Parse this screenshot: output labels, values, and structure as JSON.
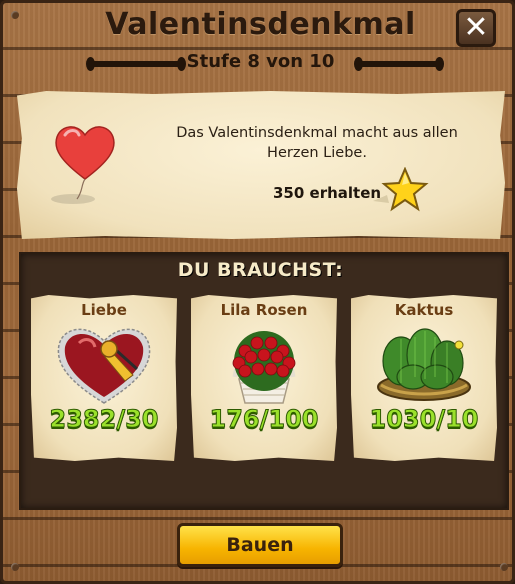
{
  "dialog": {
    "title": "Valentinsdenkmal",
    "level_text": "Stufe 8 von 10",
    "close_label": "✕"
  },
  "info": {
    "description": "Das Valentinsdenkmal macht aus allen Herzen Liebe.",
    "reward_text": "350 erhalten",
    "reward_icon": "star-icon"
  },
  "requirements": {
    "title": "DU BRAUCHST:",
    "items": [
      {
        "name": "Liebe",
        "count": "2382/30",
        "icon": "heart-gift-icon"
      },
      {
        "name": "Lila Rosen",
        "count": "176/100",
        "icon": "rose-basket-icon"
      },
      {
        "name": "Kaktus",
        "count": "1030/10",
        "icon": "cactus-basket-icon"
      }
    ]
  },
  "actions": {
    "build_label": "Bauen"
  },
  "colors": {
    "count_green": "#9be12b",
    "build_button": "#f7b400",
    "parchment": "#f1e2bd"
  }
}
